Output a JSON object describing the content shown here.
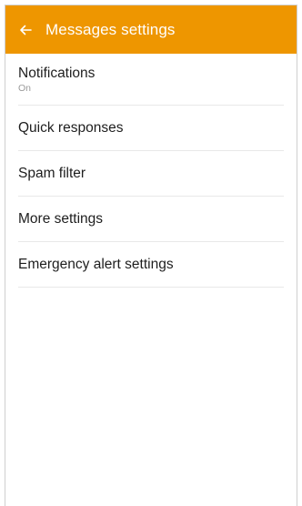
{
  "header": {
    "title": "Messages settings",
    "back_icon": "arrow-left-icon",
    "background_color": "#EE9600"
  },
  "settings": {
    "items": [
      {
        "label": "Notifications",
        "sublabel": "On"
      },
      {
        "label": "Quick responses"
      },
      {
        "label": "Spam filter"
      },
      {
        "label": "More settings"
      },
      {
        "label": "Emergency alert settings"
      }
    ]
  }
}
